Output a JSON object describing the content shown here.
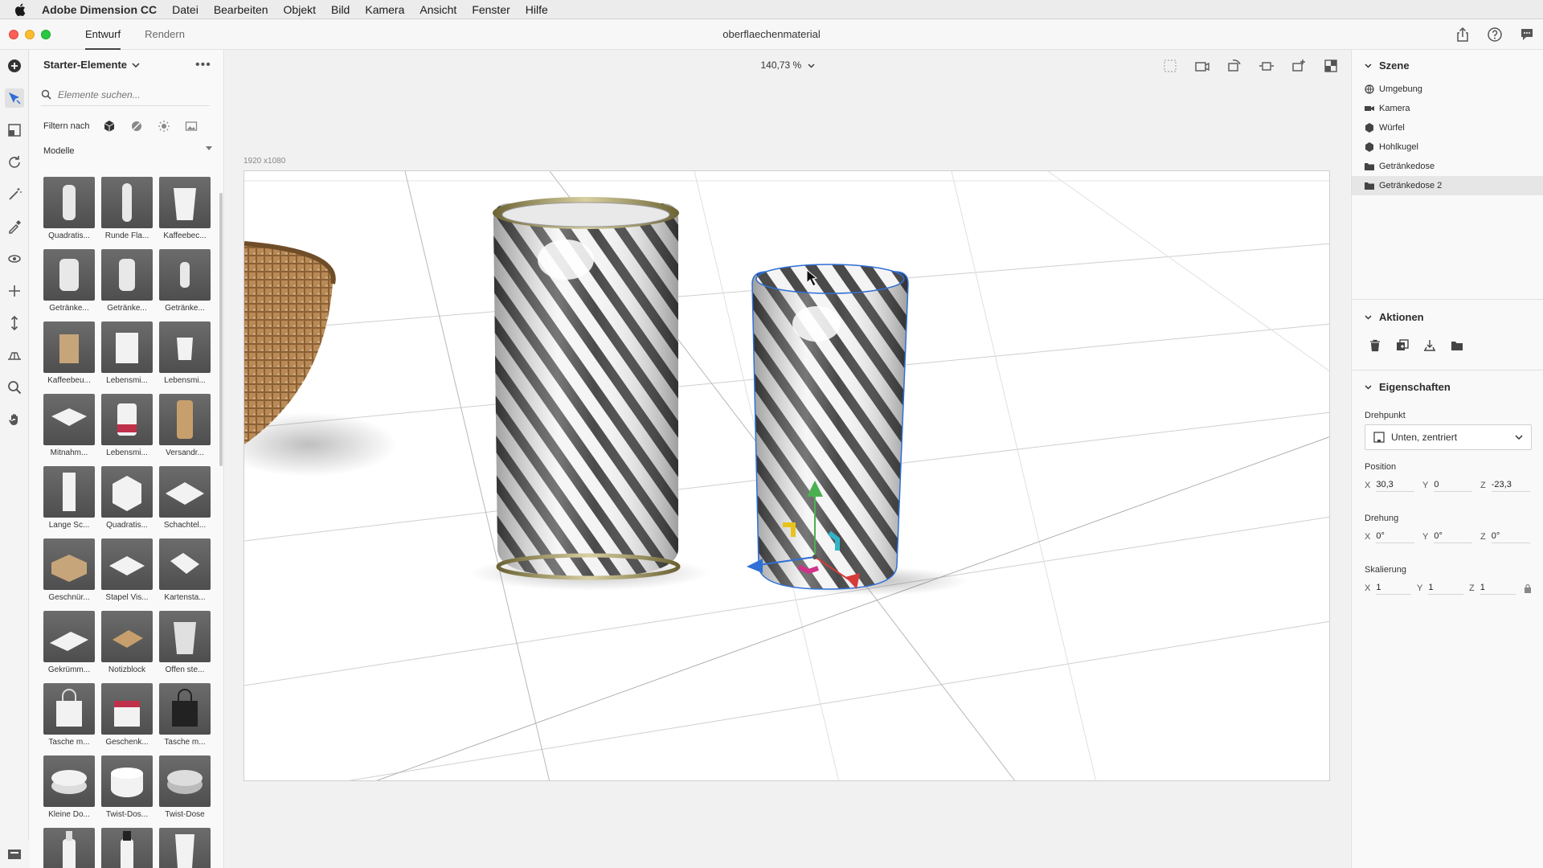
{
  "menubar": {
    "app_name": "Adobe Dimension CC",
    "items": [
      "Datei",
      "Bearbeiten",
      "Objekt",
      "Bild",
      "Kamera",
      "Ansicht",
      "Fenster",
      "Hilfe"
    ]
  },
  "titlebar": {
    "tabs": [
      "Entwurf",
      "Rendern"
    ],
    "active_tab": "Entwurf",
    "document_title": "oberflaechenmaterial"
  },
  "assets": {
    "title": "Starter-Elemente",
    "search_placeholder": "Elemente suchen...",
    "filter_label": "Filtern nach",
    "category": "Modelle",
    "models": [
      "Quadratis...",
      "Runde Fla...",
      "Kaffeebec...",
      "Getränke...",
      "Getränke...",
      "Getränke...",
      "Kaffeebeu...",
      "Lebensmi...",
      "Lebensmi...",
      "Mitnahm...",
      "Lebensmi...",
      "Versandr...",
      "Lange Sc...",
      "Quadratis...",
      "Schachtel...",
      "Geschnür...",
      "Stapel Vis...",
      "Kartensta...",
      "Gekrümm...",
      "Notizblock",
      "Offen ste...",
      "Tasche m...",
      "Geschenk...",
      "Tasche m...",
      "Kleine Do...",
      "Twist-Dos...",
      "Twist-Dose"
    ]
  },
  "canvas": {
    "zoom": "140,73 %",
    "dimensions": "1920 x1080"
  },
  "scene": {
    "title": "Szene",
    "items": [
      "Umgebung",
      "Kamera",
      "Würfel",
      "Hohlkugel",
      "Getränkedose",
      "Getränkedose 2"
    ],
    "selected": "Getränkedose 2"
  },
  "actions": {
    "title": "Aktionen"
  },
  "properties": {
    "title": "Eigenschaften",
    "pivot_label": "Drehpunkt",
    "pivot_value": "Unten, zentriert",
    "position_label": "Position",
    "position": {
      "x": "30,3",
      "y": "0",
      "z": "-23,3"
    },
    "rotation_label": "Drehung",
    "rotation": {
      "x": "0°",
      "y": "0°",
      "z": "0°"
    },
    "scale_label": "Skalierung",
    "scale": {
      "x": "1",
      "y": "1",
      "z": "1"
    }
  },
  "colors": {
    "accent_red": "#d73a3a",
    "gizmo_green": "#4cb050",
    "gizmo_blue": "#2f6fd6",
    "gizmo_yellow": "#e8c21d",
    "gizmo_cyan": "#31b4c8",
    "gizmo_magenta": "#d0338a"
  }
}
